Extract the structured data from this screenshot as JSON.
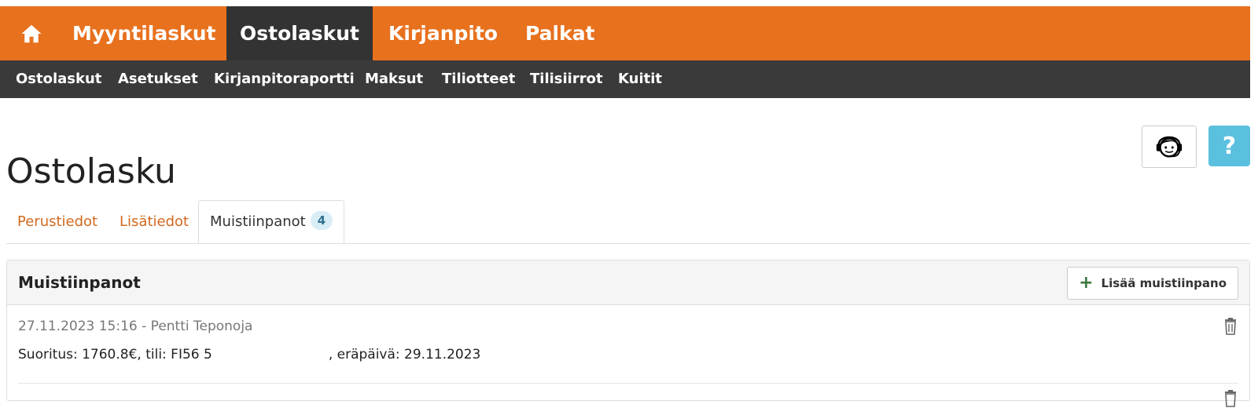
{
  "nav": {
    "main_tabs": [
      "Myyntilaskut",
      "Ostolaskut",
      "Kirjanpito",
      "Palkat"
    ],
    "active_main_tab": "Ostolaskut",
    "sub_items": [
      "Ostolaskut",
      "Asetukset",
      "Kirjanpitoraportti",
      "Maksut",
      "Tiliotteet",
      "Tilisiirrot",
      "Kuitit"
    ]
  },
  "page": {
    "title": "Ostolasku",
    "help_label": "?"
  },
  "tabs": {
    "items": [
      "Perustiedot",
      "Lisätiedot",
      "Muistiinpanot"
    ],
    "active": "Muistiinpanot",
    "notes_count": "4"
  },
  "panel": {
    "title": "Muistiinpanot",
    "add_button_label": "Lisää muistiinpano",
    "notes": [
      {
        "meta": "27.11.2023 15:16 - Pentti Teponoja",
        "text_before": "Suoritus: 1760.8€, tili: FI56 5",
        "text_after": ", eräpäivä: 29.11.2023"
      }
    ]
  },
  "colors": {
    "brand_orange": "#e8711e",
    "dark_bar": "#333333",
    "help_blue": "#5bc0de",
    "link_orange": "#d2691e",
    "add_green": "#3c763d"
  },
  "icons": {
    "home": "home-icon",
    "support": "support-agent-icon",
    "add": "plus-icon",
    "delete": "trash-icon"
  }
}
